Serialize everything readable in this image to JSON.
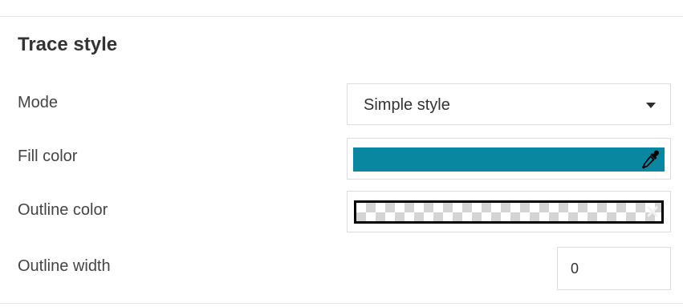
{
  "section": {
    "title": "Trace style"
  },
  "mode": {
    "label": "Mode",
    "value": "Simple style"
  },
  "fill_color": {
    "label": "Fill color",
    "color": "#0a87a0"
  },
  "outline_color": {
    "label": "Outline color",
    "color": "transparent"
  },
  "outline_width": {
    "label": "Outline width",
    "value": "0"
  },
  "icons": {
    "mode_caret": "chevron-down-icon",
    "fill_picker": "eyedropper-icon",
    "outline_clear": "clear-icon"
  }
}
